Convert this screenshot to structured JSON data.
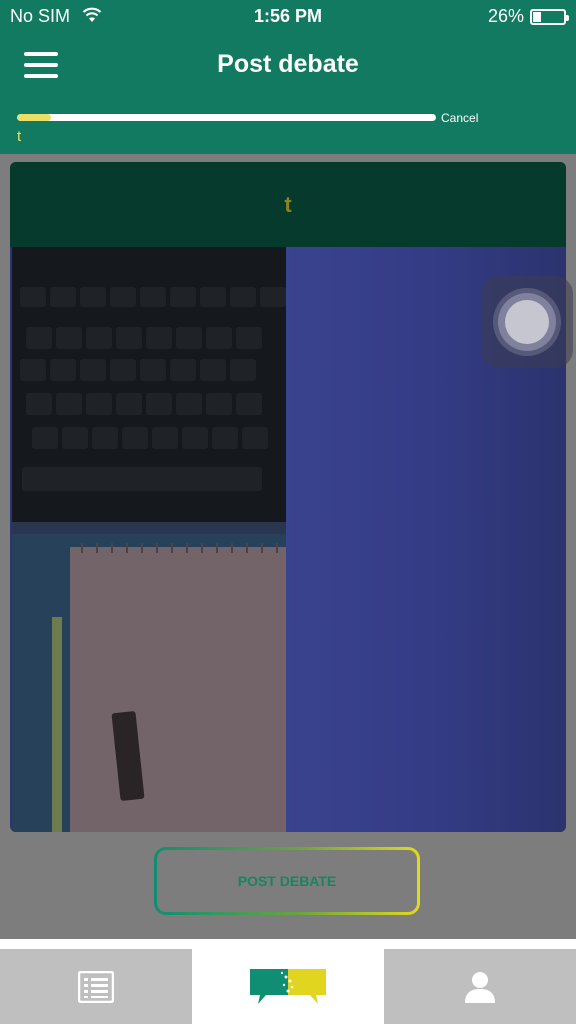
{
  "status_bar": {
    "carrier": "No SIM",
    "time": "1:56 PM",
    "battery": "26%",
    "battery_level": 0.26
  },
  "header": {
    "title": "Post debate",
    "menu_icon": "hamburger-menu-icon"
  },
  "upload": {
    "progress": 0.08,
    "cancel_label": "Cancel",
    "file_name": "t"
  },
  "card": {
    "title": "t"
  },
  "actions": {
    "post_label": "POST DEBATE"
  },
  "tabbar": {
    "items": [
      {
        "icon": "list-icon",
        "active": false
      },
      {
        "icon": "debate-logo-icon",
        "active": true
      },
      {
        "icon": "profile-icon",
        "active": false
      }
    ]
  },
  "colors": {
    "brand_green": "#117a61",
    "progress_yellow": "#e9e067",
    "card_header": "#053a2d"
  }
}
